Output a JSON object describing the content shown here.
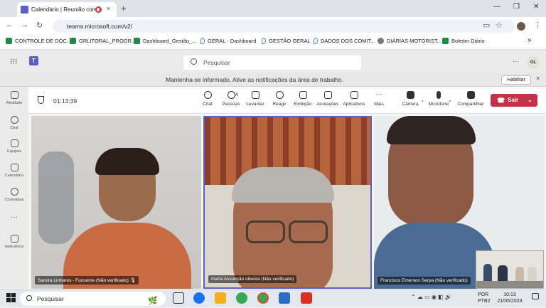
{
  "browser": {
    "tab_title": "Calendário | Reunião com o",
    "tab_close": "×",
    "new_tab": "+",
    "url": "teams.microsoft.com/v2/",
    "bookmarks": [
      {
        "label": "CONTROLE DE DOC...",
        "icon": "sheets-icon"
      },
      {
        "label": "GRLITORAL_PROGR...",
        "icon": "sheets-icon"
      },
      {
        "label": "Dashboard_Gestão_...",
        "icon": "sheets-icon"
      },
      {
        "label": "GERAL - Dashboard",
        "icon": "drop-icon"
      },
      {
        "label": "GESTÃO GERAL",
        "icon": "drop-icon"
      },
      {
        "label": "DADOS DOS COMIT...",
        "icon": "drop-icon"
      },
      {
        "label": "DIÁRIAS MOTORIST...",
        "icon": "web-icon"
      },
      {
        "label": "Boletim Diário",
        "icon": "sheets-icon"
      }
    ],
    "more_bookmarks": "»"
  },
  "teams": {
    "search_placeholder": "Pesquisar",
    "avatar_initials": "GL",
    "more": "···",
    "notification": {
      "text": "Mantenha-se informado. Ative as notificações da área de trabalho.",
      "button": "Habilitar",
      "close": "×"
    },
    "rail": [
      "Atividade",
      "Chat",
      "Equipes",
      "Calendário",
      "Chamadas",
      "···",
      "Aplicativos"
    ],
    "meeting": {
      "timer": "01:13:39",
      "people_count": "4",
      "tools": [
        "Chat",
        "Pessoas",
        "Levantar",
        "Reagir",
        "Exibição",
        "Anotações",
        "Aplicativos",
        "Mais"
      ],
      "devices": [
        "Câmera",
        "Microfone",
        "Compartilhar"
      ],
      "leave": "Sair"
    },
    "participants": [
      {
        "name": "Samira Linhares - Funceme (Não verificado)"
      },
      {
        "name": "maria Assunção oliveira (Não verificado)"
      },
      {
        "name": "Francisco Emerson Serpa (Não verificado)"
      }
    ]
  },
  "taskbar": {
    "search": "Pesquisar",
    "lang1": "POR",
    "lang2": "PTB2",
    "time": "10:13",
    "date": "21/05/2024"
  },
  "colors": {
    "accent": "#5b5fc7",
    "leave": "#c4314b"
  }
}
